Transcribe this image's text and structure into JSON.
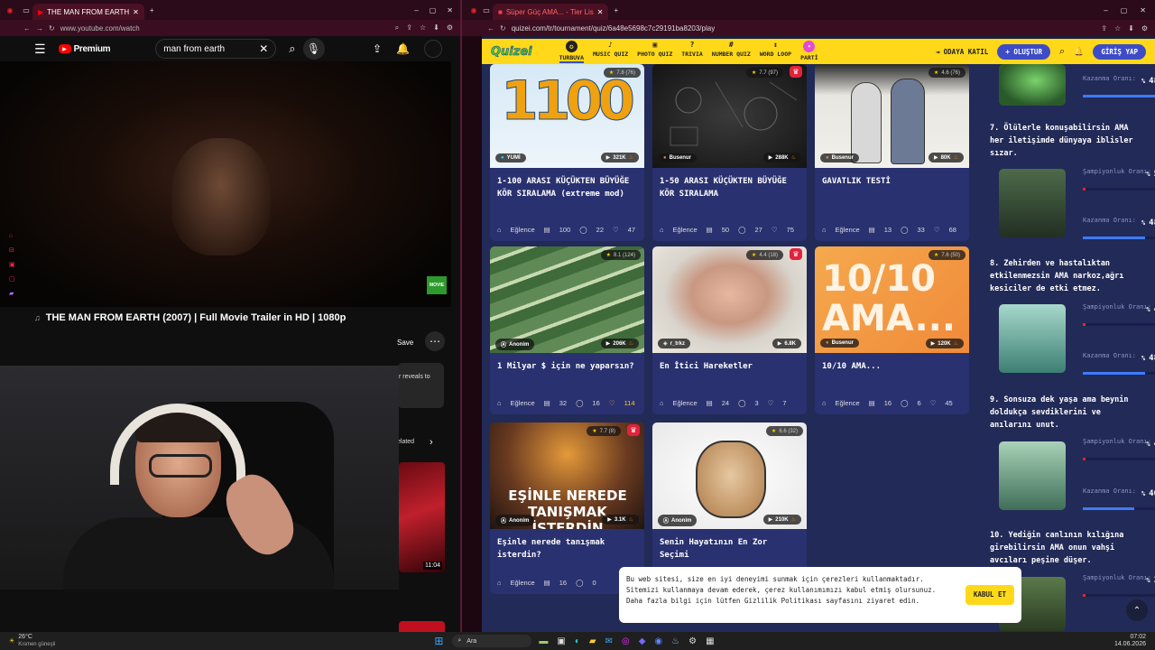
{
  "left_browser": {
    "tab_title": "THE MAN FROM EARTH",
    "url": "www.youtube.com/watch",
    "logo": "Premium",
    "search_value": "man from earth",
    "video_title": "THE MAN FROM EARTH (2007) | Full Movie Trailer in HD | 1080p",
    "save_label": "Save",
    "snippet_text": "r reveals to",
    "related_label": "elated",
    "duration": "11:04",
    "badge_text": "MOVIE"
  },
  "right_browser": {
    "tab_title": "Süper Güç AMA... - Tier Lis",
    "url": "quizei.com/tr/tournament/quiz/6a48e5698c7c29191ba8203/play",
    "logo": "Quizei",
    "nav": [
      "TURBUVA",
      "MUSIC QUIZ",
      "PHOTO QUIZ",
      "TRIVIA",
      "NUMBER QUIZ",
      "WORD LOOP",
      "PARTİ"
    ],
    "odaya_katil": "ODAYA KATIL",
    "olustur": "+ OLUŞTUR",
    "giris": "GİRİŞ YAP"
  },
  "cards": [
    {
      "rating": "7.8 (76)",
      "author": "YUMİ",
      "views": "321K",
      "title": "1-100 ARASI KÜÇÜKTEN BÜYÜĞE KÖR SIRALAMA (extreme mod)",
      "category": "Eğlence",
      "plays": "100",
      "comments": "22",
      "likes": "47",
      "thumb_text": "1100"
    },
    {
      "rating": "7.7 (97)",
      "author": "Busenur",
      "views": "288K",
      "title": "1-50 ARASI KÜÇÜKTEN BÜYÜĞE KÖR SIRALAMA",
      "category": "Eğlence",
      "plays": "50",
      "comments": "27",
      "likes": "75"
    },
    {
      "rating": "4.6 (76)",
      "author": "Busenur",
      "views": "80K",
      "title": "GAVATLIK TESTİ",
      "category": "Eğlence",
      "plays": "13",
      "comments": "33",
      "likes": "68"
    },
    {
      "rating": "8.1 (124)",
      "author": "Anonim",
      "views": "206K",
      "title": "1 Milyar $ için ne yaparsın?",
      "category": "Eğlence",
      "plays": "32",
      "comments": "16",
      "likes": "114"
    },
    {
      "rating": "4.4 (18)",
      "author": "r_trkz",
      "views": "6.8K",
      "title": "En İtici Hareketler",
      "category": "Eğlence",
      "plays": "24",
      "comments": "3",
      "likes": "7"
    },
    {
      "rating": "7.6 (50)",
      "author": "Busenur",
      "views": "120K",
      "title": "10/10 AMA...",
      "category": "Eğlence",
      "plays": "16",
      "comments": "6",
      "likes": "45",
      "thumb_text": "10/10 AMA..."
    },
    {
      "rating": "7.7 (8)",
      "author": "Anonim",
      "views": "3.1K",
      "title": "Eşinle nerede tanışmak isterdin?",
      "category": "Eğlence",
      "plays": "16",
      "comments": "0",
      "likes": "",
      "thumb_text": "EŞİNLE NEREDE TANIŞMAK İSTERDİN"
    },
    {
      "rating": "6.6 (32)",
      "author": "Anonim",
      "views": "210K",
      "title": "Senin Hayatının En Zor Seçimi",
      "category": "",
      "plays": "",
      "comments": "",
      "likes": ""
    }
  ],
  "sidebar": [
    {
      "text": "",
      "sampiyon_label": "Kazanma Oranı:",
      "sampiyon_val": "48",
      "kazanma_label": "",
      "kazanma_val": ""
    },
    {
      "text": "7. Ölülerle konuşabilirsin AMA her iletişimde dünyaya iblisler sızar.",
      "sampiyon_label": "Şampiyonluk Oranı:",
      "sampiyon_val": "5",
      "kazanma_label": "Kazanma Oranı:",
      "kazanma_val": "48"
    },
    {
      "text": "8. Zehirden ve hastalıktan etkilenmezsin AMA narkoz,ağrı kesiciler de etki etmez.",
      "sampiyon_label": "Şampiyonluk Oranı:",
      "sampiyon_val": "4",
      "kazanma_label": "Kazanma Oranı:",
      "kazanma_val": "48"
    },
    {
      "text": "9. Sonsuza dek yaşa ama beynin doldukça sevdiklerini ve anılarını unut.",
      "sampiyon_label": "Şampiyonluk Oranı:",
      "sampiyon_val": "4",
      "kazanma_label": "Kazanma Oranı:",
      "kazanma_val": "40"
    },
    {
      "text": "10. Yediğin canlının kılığına girebilirsin AMA onun vahşi avcıları peşine düşer.",
      "sampiyon_label": "Şampiyonluk Oranı:",
      "sampiyon_val": "3",
      "kazanma_label": "",
      "kazanma_val": ""
    }
  ],
  "cookie": {
    "text": "Bu web sitesi, size en iyi deneyimi sunmak için çerezleri kullanmaktadır. Sitemizi kullanmaya devam ederek, çerez kullanımımızı kabul etmiş olursunuz. Daha fazla bilgi için lütfen Gizlilik Politikası sayfasını ziyaret edin.",
    "button": "KABUL ET"
  },
  "taskbar": {
    "weather_temp": "26°C",
    "weather_desc": "Kısmen güneşli",
    "search": "Ara",
    "time": "07:02",
    "date": "14.06.2026"
  },
  "colors": {
    "quizei_yellow": "#ffd81a",
    "quizei_bg": "#222a57",
    "card_bg": "#2a3170",
    "browser_maroon": "#2b0b19"
  }
}
